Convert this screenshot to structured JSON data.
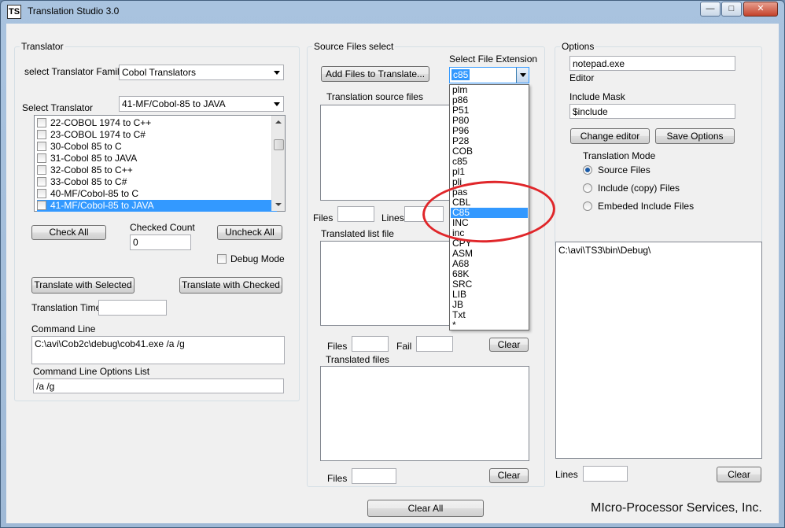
{
  "window": {
    "title": "Translation Studio 3.0",
    "icon_text": "TS",
    "minimize_glyph": "—",
    "maximize_glyph": "□",
    "close_glyph": "✕"
  },
  "translator": {
    "group_title": "Translator",
    "family_label": "select Translator  Family",
    "family_value": "Cobol Translators",
    "select_label": "Select Translator",
    "select_value": "41-MF/Cobol-85 to JAVA",
    "items": [
      {
        "label": "22-COBOL 1974 to C++",
        "selected": false
      },
      {
        "label": "23-COBOL 1974 to C#",
        "selected": false
      },
      {
        "label": "30-Cobol 85 to C",
        "selected": false
      },
      {
        "label": "31-Cobol 85 to JAVA",
        "selected": false
      },
      {
        "label": "32-Cobol 85 to C++",
        "selected": false
      },
      {
        "label": "33-Cobol 85 to C#",
        "selected": false
      },
      {
        "label": "40-MF/Cobol-85 to C",
        "selected": false
      },
      {
        "label": "41-MF/Cobol-85 to JAVA",
        "selected": true
      }
    ],
    "check_all_label": "Check All",
    "checked_count_label": "Checked Count",
    "checked_count_value": "0",
    "uncheck_all_label": "Uncheck All",
    "debug_mode_label": "Debug Mode",
    "translate_selected_label": "Translate  with  Selected",
    "translate_checked_label": "Translate with Checked",
    "translation_time_label": "Translation Time",
    "translation_time_value": "",
    "command_line_label": "Command Line",
    "command_line_value": "C:\\avi\\Cob2c\\debug\\cob41.exe  /a /g",
    "command_options_label": "Command Line Options List",
    "command_options_value": "/a /g"
  },
  "source": {
    "group_title": "Source Files select",
    "add_files_label": "Add Files to Translate...",
    "ext_label": "Select File Extension",
    "ext_value": "c85",
    "source_files_label": "Translation source files",
    "files_label": "Files",
    "lines_label": "Lines",
    "translated_list_label": "Translated list file",
    "files2_label": "Files",
    "fail_label": "Fail",
    "clear1_label": "Clear",
    "translated_files_label": "Translated files",
    "files3_label": "Files",
    "clear2_label": "Clear",
    "extensions": [
      "plm",
      "p86",
      "P51",
      "P80",
      "P96",
      "P28",
      "COB",
      "c85",
      "pl1",
      "pli",
      "pas",
      "CBL",
      "C85",
      "INC",
      "inc",
      "CPY",
      "ASM",
      "A68",
      "68K",
      "SRC",
      "LIB",
      "JB",
      "Txt",
      "*"
    ],
    "highlighted_extension": "C85"
  },
  "options": {
    "group_title": "Options",
    "editor_value": "notepad.exe",
    "editor_label": "Editor",
    "include_mask_label": "Include Mask",
    "include_mask_value": "$include",
    "change_editor_label": "Change editor",
    "save_options_label": "Save Options",
    "mode_label": "Translation Mode",
    "modes": [
      {
        "label": "Source Files",
        "checked": true
      },
      {
        "label": "Include (copy) Files",
        "checked": false
      },
      {
        "label": "Embeded Include Files",
        "checked": false
      }
    ],
    "output_text": "C:\\avi\\TS3\\bin\\Debug\\",
    "lines_label": "Lines",
    "clear_label": "Clear"
  },
  "footer": {
    "clear_all_label": "Clear All",
    "company": "MIcro-Processor Services, Inc."
  },
  "colors": {
    "selection": "#3399ff",
    "annotation": "#e0262a"
  }
}
